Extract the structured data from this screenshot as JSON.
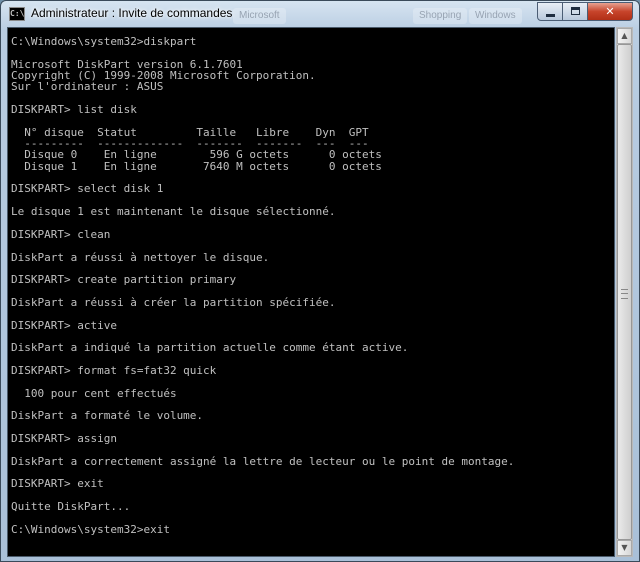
{
  "window": {
    "title": "Administrateur : Invite de commandes",
    "icon_text": "C:\\",
    "controls": {
      "minimize": "minimize-icon",
      "maximize": "maximize-icon",
      "close": "✕"
    }
  },
  "background_tabs": [
    "Microsoft",
    "Shopping",
    "Windows"
  ],
  "console": {
    "lines": [
      "C:\\Windows\\system32>diskpart",
      "",
      "Microsoft DiskPart version 6.1.7601",
      "Copyright (C) 1999-2008 Microsoft Corporation.",
      "Sur l'ordinateur : ASUS",
      "",
      "DISKPART> list disk",
      "",
      "  N° disque  Statut         Taille   Libre    Dyn  GPT",
      "  ---------  -------------  -------  -------  ---  ---",
      "  Disque 0    En ligne        596 G octets      0 octets",
      "  Disque 1    En ligne       7640 M octets      0 octets",
      "",
      "DISKPART> select disk 1",
      "",
      "Le disque 1 est maintenant le disque sélectionné.",
      "",
      "DISKPART> clean",
      "",
      "DiskPart a réussi à nettoyer le disque.",
      "",
      "DISKPART> create partition primary",
      "",
      "DiskPart a réussi à créer la partition spécifiée.",
      "",
      "DISKPART> active",
      "",
      "DiskPart a indiqué la partition actuelle comme étant active.",
      "",
      "DISKPART> format fs=fat32 quick",
      "",
      "  100 pour cent effectués",
      "",
      "DiskPart a formaté le volume.",
      "",
      "DISKPART> assign",
      "",
      "DiskPart a correctement assigné la lettre de lecteur ou le point de montage.",
      "",
      "DISKPART> exit",
      "",
      "Quitte DiskPart...",
      "",
      "C:\\Windows\\system32>exit"
    ]
  },
  "scrollbar": {
    "up_arrow": "▲",
    "down_arrow": "▼"
  }
}
